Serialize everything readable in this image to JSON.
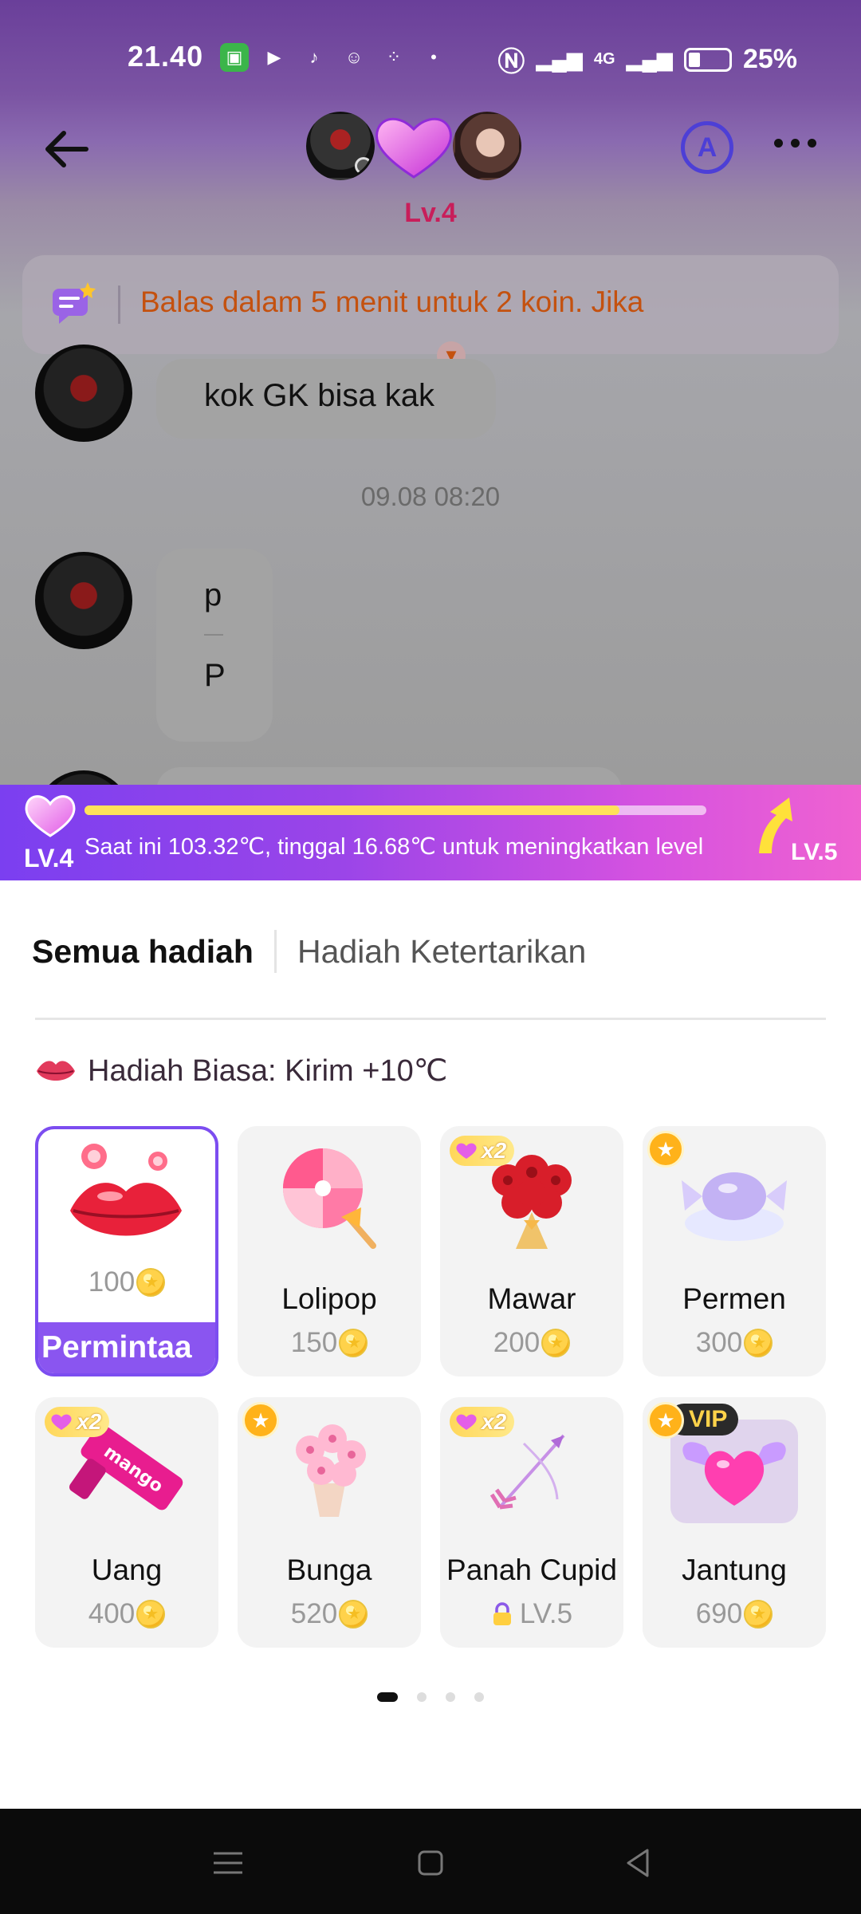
{
  "status_bar": {
    "time": "21.40",
    "battery": "25%",
    "network": "4G"
  },
  "header": {
    "level": "Lv.4"
  },
  "notice": {
    "text": "Balas dalam 5 menit untuk 2 koin. Jika"
  },
  "chat": {
    "messages": [
      {
        "text": "kok GK bisa kak"
      },
      {
        "timestamp": "09.08 08:20"
      },
      {
        "lines": [
          "p",
          "P"
        ]
      }
    ]
  },
  "level_bar": {
    "current_level": "LV.4",
    "next_level": "LV.5",
    "progress": 0.86,
    "text": "Saat ini 103.32℃, tinggal 16.68℃ untuk meningkatkan level"
  },
  "gift_panel": {
    "tabs": [
      {
        "label": "Semua hadiah",
        "active": true
      },
      {
        "label": "Hadiah Ketertarikan",
        "active": false
      }
    ],
    "section_title": "Hadiah Biasa: Kirim +10℃",
    "gifts": [
      {
        "name": "",
        "price": "100",
        "selected": true,
        "action_label": "Permintaa",
        "badge": ""
      },
      {
        "name": "Lolipop",
        "price": "150",
        "badge": ""
      },
      {
        "name": "Mawar",
        "price": "200",
        "badge": "x2"
      },
      {
        "name": "Permen",
        "price": "300",
        "badge": "star"
      },
      {
        "name": "Uang",
        "price": "400",
        "badge": "x2"
      },
      {
        "name": "Bunga",
        "price": "520",
        "badge": "star"
      },
      {
        "name": "Panah Cupid",
        "price": "LV.5",
        "locked": true,
        "badge": "x2"
      },
      {
        "name": "Jantung",
        "price": "690",
        "badge": "star",
        "vip": "VIP"
      }
    ],
    "badge_x2_label": "x2",
    "pages": 4,
    "current_page": 1
  },
  "colors": {
    "accent": "#8a55f0",
    "level_text": "#c81e5a",
    "notice_text": "#c4510f"
  }
}
